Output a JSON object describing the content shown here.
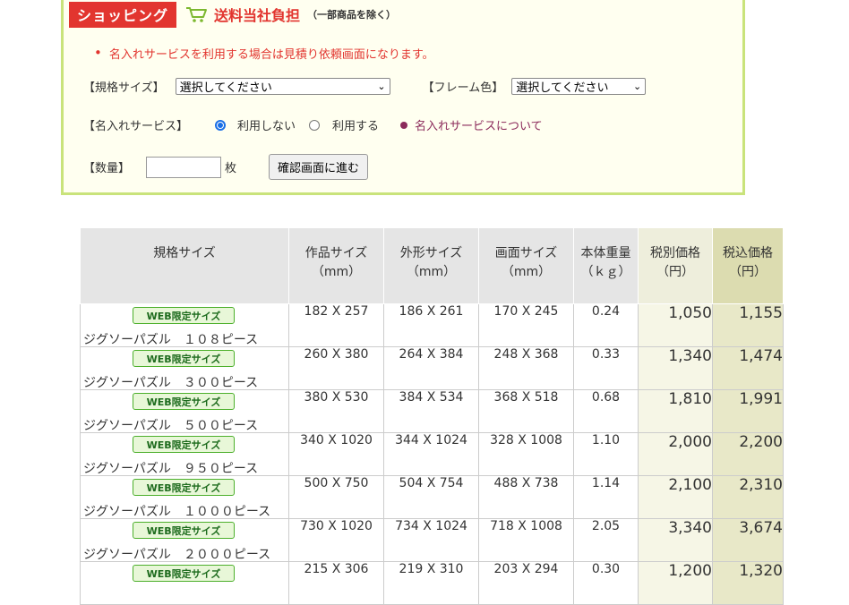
{
  "order": {
    "shop_label": "ショッピング",
    "free_shipping": "送料当社負担",
    "free_shipping_note": "（一部商品を除く）",
    "notice": "名入れサービスを利用する場合は見積り依頼画面になります。",
    "size_label": "【規格サイズ】",
    "size_select_value": "選択してください",
    "frame_label": "【フレーム色】",
    "frame_select_value": "選択してください",
    "name_service_label": "【名入れサービス】",
    "radio_no_label": "利用しない",
    "radio_yes_label": "利用する",
    "name_service_link": "名入れサービスについて",
    "quantity_label": "【数量】",
    "quantity_value": "",
    "quantity_unit": "枚",
    "confirm_button": "確認画面に進む"
  },
  "table": {
    "headers": {
      "size": "規格サイズ",
      "work_size": "作品サイズ",
      "outer_size": "外形サイズ",
      "screen_size": "画面サイズ",
      "weight": "本体重量",
      "mm": "（mm）",
      "kg": "（ｋｇ）",
      "price_ex": "税別価格",
      "price_in": "税込価格",
      "yen": "（円）"
    },
    "web_badge": "WEB限定サイズ",
    "rows": [
      {
        "name": "ジグソーパズル　１０８ピース",
        "work": "182 X 257",
        "outer": "186 X 261",
        "screen": "170 X 245",
        "weight": "0.24",
        "ex": "1,050",
        "inc": "1,155"
      },
      {
        "name": "ジグソーパズル　３００ピース",
        "work": "260 X 380",
        "outer": "264 X 384",
        "screen": "248 X 368",
        "weight": "0.33",
        "ex": "1,340",
        "inc": "1,474"
      },
      {
        "name": "ジグソーパズル　５００ピース",
        "work": "380 X 530",
        "outer": "384 X 534",
        "screen": "368 X 518",
        "weight": "0.68",
        "ex": "1,810",
        "inc": "1,991"
      },
      {
        "name": "ジグソーパズル　９５０ピース",
        "work": "340 X 1020",
        "outer": "344 X 1024",
        "screen": "328 X 1008",
        "weight": "1.10",
        "ex": "2,000",
        "inc": "2,200"
      },
      {
        "name": "ジグソーパズル　１０００ピース",
        "work": "500 X 750",
        "outer": "504 X 754",
        "screen": "488 X 738",
        "weight": "1.14",
        "ex": "2,100",
        "inc": "2,310"
      },
      {
        "name": "ジグソーパズル　２０００ピース",
        "work": "730 X 1020",
        "outer": "734 X 1024",
        "screen": "718 X 1008",
        "weight": "2.05",
        "ex": "3,340",
        "inc": "3,674"
      },
      {
        "name": "",
        "work": "215 X 306",
        "outer": "219 X 310",
        "screen": "203 X 294",
        "weight": "0.30",
        "ex": "1,200",
        "inc": "1,320"
      }
    ]
  }
}
